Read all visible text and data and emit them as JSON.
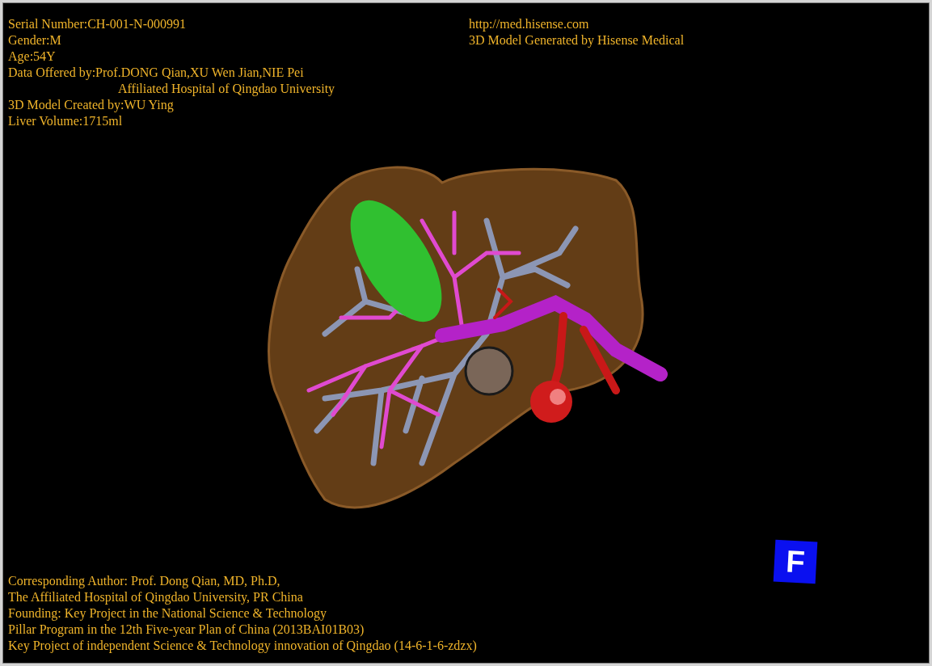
{
  "patient_info": [
    {
      "kind": "field",
      "text": "Serial Number:CH-001-N-000991"
    },
    {
      "kind": "field",
      "text": "Gender:M"
    },
    {
      "kind": "field",
      "text": "Age:54Y"
    },
    {
      "kind": "field",
      "text": "Data Offered by:Prof.DONG Qian,XU Wen Jian,NIE Pei"
    },
    {
      "kind": "continuation",
      "text": "Affiliated Hospital of Qingdao University"
    },
    {
      "kind": "field",
      "text": "3D Model Created by:WU Ying"
    },
    {
      "kind": "field",
      "text": "Liver Volume:1715ml"
    }
  ],
  "generator_info": [
    "http://med.hisense.com",
    "3D Model Generated by Hisense Medical"
  ],
  "credits": [
    "Corresponding Author: Prof. Dong Qian, MD, Ph.D,",
    "The Affiliated Hospital of Qingdao University, PR China",
    "Founding: Key Project in the National Science & Technology",
    "Pillar Program in the 12th Five-year Plan of China (2013BAI01B03)",
    "Key Project of independent Science & Technology innovation of Qingdao (14-6-1-6-zdzx)"
  ],
  "orientation_marker": "F"
}
